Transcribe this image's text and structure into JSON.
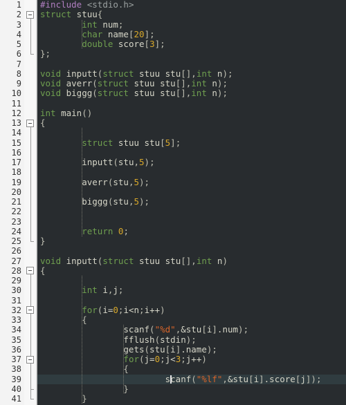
{
  "editor": {
    "name": "c-source-code-editor",
    "language": "C",
    "total_lines": 41,
    "current_line": 39,
    "theme": {
      "code_background": "#282c2f",
      "gutter_background": "#f3f3f3",
      "fold_margin_background": "#f7f7f7",
      "current_line_background": "#303c40",
      "default_text": "#d6d6c8",
      "keyword": "#6f9f4f",
      "preprocessor": "#b07ec0",
      "include_path": "#9aa0a0",
      "number": "#d8a82a",
      "string": "#d6642a",
      "line_number": "#333333",
      "caret": "#e8e8e8"
    }
  },
  "line_numbers": [
    "1",
    "2",
    "3",
    "4",
    "5",
    "6",
    "7",
    "8",
    "9",
    "10",
    "11",
    "12",
    "13",
    "14",
    "15",
    "16",
    "17",
    "18",
    "19",
    "20",
    "21",
    "22",
    "23",
    "24",
    "25",
    "26",
    "27",
    "28",
    "29",
    "30",
    "31",
    "32",
    "33",
    "34",
    "35",
    "36",
    "37",
    "38",
    "39",
    "40",
    "41"
  ],
  "fold_markers": [
    {
      "line": 2,
      "state": "expanded",
      "symbol": "minus"
    },
    {
      "line": 13,
      "state": "expanded",
      "symbol": "minus"
    },
    {
      "line": 28,
      "state": "expanded",
      "symbol": "minus"
    },
    {
      "line": 32,
      "state": "expanded",
      "symbol": "minus"
    },
    {
      "line": 37,
      "state": "expanded",
      "symbol": "minus"
    }
  ],
  "code_lines": [
    {
      "n": 1,
      "text": "#include <stdio.h>"
    },
    {
      "n": 2,
      "text": "struct stuu{"
    },
    {
      "n": 3,
      "text": "        int num;"
    },
    {
      "n": 4,
      "text": "        char name[20];"
    },
    {
      "n": 5,
      "text": "        double score[3];"
    },
    {
      "n": 6,
      "text": "};"
    },
    {
      "n": 7,
      "text": ""
    },
    {
      "n": 8,
      "text": "void inputt(struct stuu stu[],int n);"
    },
    {
      "n": 9,
      "text": "void averr(struct stuu stu[],int n);"
    },
    {
      "n": 10,
      "text": "void biggg(struct stuu stu[],int n);"
    },
    {
      "n": 11,
      "text": ""
    },
    {
      "n": 12,
      "text": "int main()"
    },
    {
      "n": 13,
      "text": "{"
    },
    {
      "n": 14,
      "text": ""
    },
    {
      "n": 15,
      "text": "        struct stuu stu[5];"
    },
    {
      "n": 16,
      "text": ""
    },
    {
      "n": 17,
      "text": "        inputt(stu,5);"
    },
    {
      "n": 18,
      "text": ""
    },
    {
      "n": 19,
      "text": "        averr(stu,5);"
    },
    {
      "n": 20,
      "text": ""
    },
    {
      "n": 21,
      "text": "        biggg(stu,5);"
    },
    {
      "n": 22,
      "text": ""
    },
    {
      "n": 23,
      "text": ""
    },
    {
      "n": 24,
      "text": "        return 0;"
    },
    {
      "n": 25,
      "text": "}"
    },
    {
      "n": 26,
      "text": ""
    },
    {
      "n": 27,
      "text": "void inputt(struct stuu stu[],int n)"
    },
    {
      "n": 28,
      "text": "{"
    },
    {
      "n": 29,
      "text": ""
    },
    {
      "n": 30,
      "text": "        int i,j;"
    },
    {
      "n": 31,
      "text": ""
    },
    {
      "n": 32,
      "text": "        for(i=0;i<n;i++)"
    },
    {
      "n": 33,
      "text": "        {"
    },
    {
      "n": 34,
      "text": "                scanf(\"%d\",&stu[i].num);"
    },
    {
      "n": 35,
      "text": "                fflush(stdin);"
    },
    {
      "n": 36,
      "text": "                gets(stu[i].name);"
    },
    {
      "n": 37,
      "text": "                for(j=0;j<3;j++)"
    },
    {
      "n": 38,
      "text": "                {"
    },
    {
      "n": 39,
      "text": "                        scanf(\"%lf\",&stu[i].score[j]);"
    },
    {
      "n": 40,
      "text": "                }"
    },
    {
      "n": 41,
      "text": "        }"
    }
  ],
  "tokens": {
    "line1": [
      [
        "#include",
        "t-pre"
      ],
      [
        " ",
        "t-id"
      ],
      [
        "<stdio.h>",
        "t-inc"
      ]
    ],
    "line2": [
      [
        "struct",
        "t-kw"
      ],
      [
        " stuu",
        "t-id"
      ],
      [
        "{",
        "t-punc"
      ]
    ],
    "line3": [
      [
        "        ",
        "t-id"
      ],
      [
        "int",
        "t-kw"
      ],
      [
        " num",
        "t-id"
      ],
      [
        ";",
        "t-punc"
      ]
    ],
    "line4": [
      [
        "        ",
        "t-id"
      ],
      [
        "char",
        "t-kw"
      ],
      [
        " name",
        "t-id"
      ],
      [
        "[",
        "t-punc"
      ],
      [
        "20",
        "t-num"
      ],
      [
        "]",
        "t-punc"
      ],
      [
        ";",
        "t-punc"
      ]
    ],
    "line5": [
      [
        "        ",
        "t-id"
      ],
      [
        "double",
        "t-kw"
      ],
      [
        " score",
        "t-id"
      ],
      [
        "[",
        "t-punc"
      ],
      [
        "3",
        "t-num"
      ],
      [
        "]",
        "t-punc"
      ],
      [
        ";",
        "t-punc"
      ]
    ],
    "line6": [
      [
        "}",
        "t-punc"
      ],
      [
        ";",
        "t-punc"
      ]
    ],
    "line8": [
      [
        "void",
        "t-kw"
      ],
      [
        " inputt",
        "t-id"
      ],
      [
        "(",
        "t-punc"
      ],
      [
        "struct",
        "t-kw"
      ],
      [
        " stuu stu",
        "t-id"
      ],
      [
        "[]",
        "t-punc"
      ],
      [
        ",",
        "t-punc"
      ],
      [
        "int",
        "t-kw"
      ],
      [
        " n",
        "t-id"
      ],
      [
        ")",
        "t-punc"
      ],
      [
        ";",
        "t-punc"
      ]
    ],
    "line9": [
      [
        "void",
        "t-kw"
      ],
      [
        " averr",
        "t-id"
      ],
      [
        "(",
        "t-punc"
      ],
      [
        "struct",
        "t-kw"
      ],
      [
        " stuu stu",
        "t-id"
      ],
      [
        "[]",
        "t-punc"
      ],
      [
        ",",
        "t-punc"
      ],
      [
        "int",
        "t-kw"
      ],
      [
        " n",
        "t-id"
      ],
      [
        ")",
        "t-punc"
      ],
      [
        ";",
        "t-punc"
      ]
    ],
    "line10": [
      [
        "void",
        "t-kw"
      ],
      [
        " biggg",
        "t-id"
      ],
      [
        "(",
        "t-punc"
      ],
      [
        "struct",
        "t-kw"
      ],
      [
        " stuu stu",
        "t-id"
      ],
      [
        "[]",
        "t-punc"
      ],
      [
        ",",
        "t-punc"
      ],
      [
        "int",
        "t-kw"
      ],
      [
        " n",
        "t-id"
      ],
      [
        ")",
        "t-punc"
      ],
      [
        ";",
        "t-punc"
      ]
    ],
    "line12": [
      [
        "int",
        "t-kw"
      ],
      [
        " main",
        "t-id"
      ],
      [
        "()",
        "t-punc"
      ]
    ],
    "line13": [
      [
        "{",
        "t-punc"
      ]
    ],
    "line15": [
      [
        "        ",
        "t-id"
      ],
      [
        "struct",
        "t-kw"
      ],
      [
        " stuu stu",
        "t-id"
      ],
      [
        "[",
        "t-punc"
      ],
      [
        "5",
        "t-num"
      ],
      [
        "]",
        "t-punc"
      ],
      [
        ";",
        "t-punc"
      ]
    ],
    "line17": [
      [
        "        inputt",
        "t-id"
      ],
      [
        "(",
        "t-punc"
      ],
      [
        "stu",
        "t-id"
      ],
      [
        ",",
        "t-punc"
      ],
      [
        "5",
        "t-num"
      ],
      [
        ")",
        "t-punc"
      ],
      [
        ";",
        "t-punc"
      ]
    ],
    "line19": [
      [
        "        averr",
        "t-id"
      ],
      [
        "(",
        "t-punc"
      ],
      [
        "stu",
        "t-id"
      ],
      [
        ",",
        "t-punc"
      ],
      [
        "5",
        "t-num"
      ],
      [
        ")",
        "t-punc"
      ],
      [
        ";",
        "t-punc"
      ]
    ],
    "line21": [
      [
        "        biggg",
        "t-id"
      ],
      [
        "(",
        "t-punc"
      ],
      [
        "stu",
        "t-id"
      ],
      [
        ",",
        "t-punc"
      ],
      [
        "5",
        "t-num"
      ],
      [
        ")",
        "t-punc"
      ],
      [
        ";",
        "t-punc"
      ]
    ],
    "line24": [
      [
        "        ",
        "t-id"
      ],
      [
        "return",
        "t-kw"
      ],
      [
        " ",
        "t-id"
      ],
      [
        "0",
        "t-num"
      ],
      [
        ";",
        "t-punc"
      ]
    ],
    "line25": [
      [
        "}",
        "t-punc"
      ]
    ],
    "line27": [
      [
        "void",
        "t-kw"
      ],
      [
        " inputt",
        "t-id"
      ],
      [
        "(",
        "t-punc"
      ],
      [
        "struct",
        "t-kw"
      ],
      [
        " stuu stu",
        "t-id"
      ],
      [
        "[]",
        "t-punc"
      ],
      [
        ",",
        "t-punc"
      ],
      [
        "int",
        "t-kw"
      ],
      [
        " n",
        "t-id"
      ],
      [
        ")",
        "t-punc"
      ]
    ],
    "line28": [
      [
        "{",
        "t-punc"
      ]
    ],
    "line30": [
      [
        "        ",
        "t-id"
      ],
      [
        "int",
        "t-kw"
      ],
      [
        " i",
        "t-id"
      ],
      [
        ",",
        "t-punc"
      ],
      [
        "j",
        "t-id"
      ],
      [
        ";",
        "t-punc"
      ]
    ],
    "line32": [
      [
        "        ",
        "t-id"
      ],
      [
        "for",
        "t-kw"
      ],
      [
        "(",
        "t-punc"
      ],
      [
        "i=",
        "t-id"
      ],
      [
        "0",
        "t-num"
      ],
      [
        ";",
        "t-punc"
      ],
      [
        "i<n",
        "t-id"
      ],
      [
        ";",
        "t-punc"
      ],
      [
        "i++",
        "t-id"
      ],
      [
        ")",
        "t-punc"
      ]
    ],
    "line33": [
      [
        "        {",
        "t-punc"
      ]
    ],
    "line34": [
      [
        "                scanf",
        "t-id"
      ],
      [
        "(",
        "t-punc"
      ],
      [
        "\"%d\"",
        "t-str"
      ],
      [
        ",",
        "t-punc"
      ],
      [
        "&stu",
        "t-id"
      ],
      [
        "[",
        "t-punc"
      ],
      [
        "i",
        "t-id"
      ],
      [
        "]",
        "t-punc"
      ],
      [
        ".num",
        "t-id"
      ],
      [
        ")",
        "t-punc"
      ],
      [
        ";",
        "t-punc"
      ]
    ],
    "line35": [
      [
        "                fflush",
        "t-id"
      ],
      [
        "(",
        "t-punc"
      ],
      [
        "stdin",
        "t-id"
      ],
      [
        ")",
        "t-punc"
      ],
      [
        ";",
        "t-punc"
      ]
    ],
    "line36": [
      [
        "                gets",
        "t-id"
      ],
      [
        "(",
        "t-punc"
      ],
      [
        "stu",
        "t-id"
      ],
      [
        "[",
        "t-punc"
      ],
      [
        "i",
        "t-id"
      ],
      [
        "]",
        "t-punc"
      ],
      [
        ".name",
        "t-id"
      ],
      [
        ")",
        "t-punc"
      ],
      [
        ";",
        "t-punc"
      ]
    ],
    "line37": [
      [
        "                ",
        "t-id"
      ],
      [
        "for",
        "t-kw"
      ],
      [
        "(",
        "t-punc"
      ],
      [
        "j=",
        "t-id"
      ],
      [
        "0",
        "t-num"
      ],
      [
        ";",
        "t-punc"
      ],
      [
        "j<",
        "t-id"
      ],
      [
        "3",
        "t-num"
      ],
      [
        ";",
        "t-punc"
      ],
      [
        "j++",
        "t-id"
      ],
      [
        ")",
        "t-punc"
      ]
    ],
    "line38": [
      [
        "                {",
        "t-punc"
      ]
    ],
    "line39": [
      [
        "                        scanf",
        "t-id"
      ],
      [
        "(",
        "t-punc"
      ],
      [
        "\"%lf\"",
        "t-str"
      ],
      [
        ",",
        "t-punc"
      ],
      [
        "&stu",
        "t-id"
      ],
      [
        "[",
        "t-punc"
      ],
      [
        "i",
        "t-id"
      ],
      [
        "]",
        "t-punc"
      ],
      [
        ".score",
        "t-id"
      ],
      [
        "[",
        "t-punc"
      ],
      [
        "j",
        "t-id"
      ],
      [
        "]",
        "t-punc"
      ],
      [
        ")",
        "t-punc"
      ],
      [
        ";",
        "t-punc"
      ]
    ],
    "line40": [
      [
        "                }",
        "t-punc"
      ]
    ],
    "line41": [
      [
        "        }",
        "t-punc"
      ]
    ]
  },
  "caret": {
    "line": 39,
    "column": 25,
    "visible": true
  }
}
